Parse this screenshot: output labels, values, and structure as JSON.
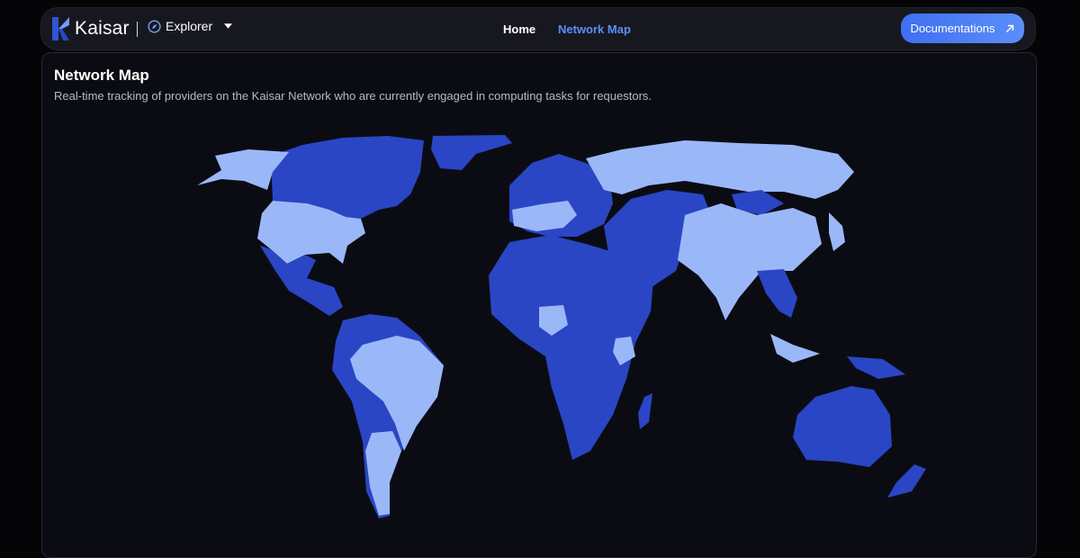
{
  "header": {
    "brand": "Kaisar",
    "explorer_label": "Explorer",
    "nav": [
      "Home",
      "Network Map"
    ],
    "active_nav": "Network Map",
    "docs_button": "Documentations"
  },
  "card": {
    "title": "Network Map",
    "subtitle": "Real-time tracking of providers on the Kaisar Network who are currently engaged in computing tasks for requestors."
  },
  "colors": {
    "background": "#050508",
    "accent": "#5b8dff",
    "active_region": "#9ab8f8",
    "inactive_region": "#2a46c4"
  },
  "icons": [
    "kaisar-logo",
    "compass-icon",
    "chevron-down-icon",
    "arrow-up-right-icon"
  ]
}
